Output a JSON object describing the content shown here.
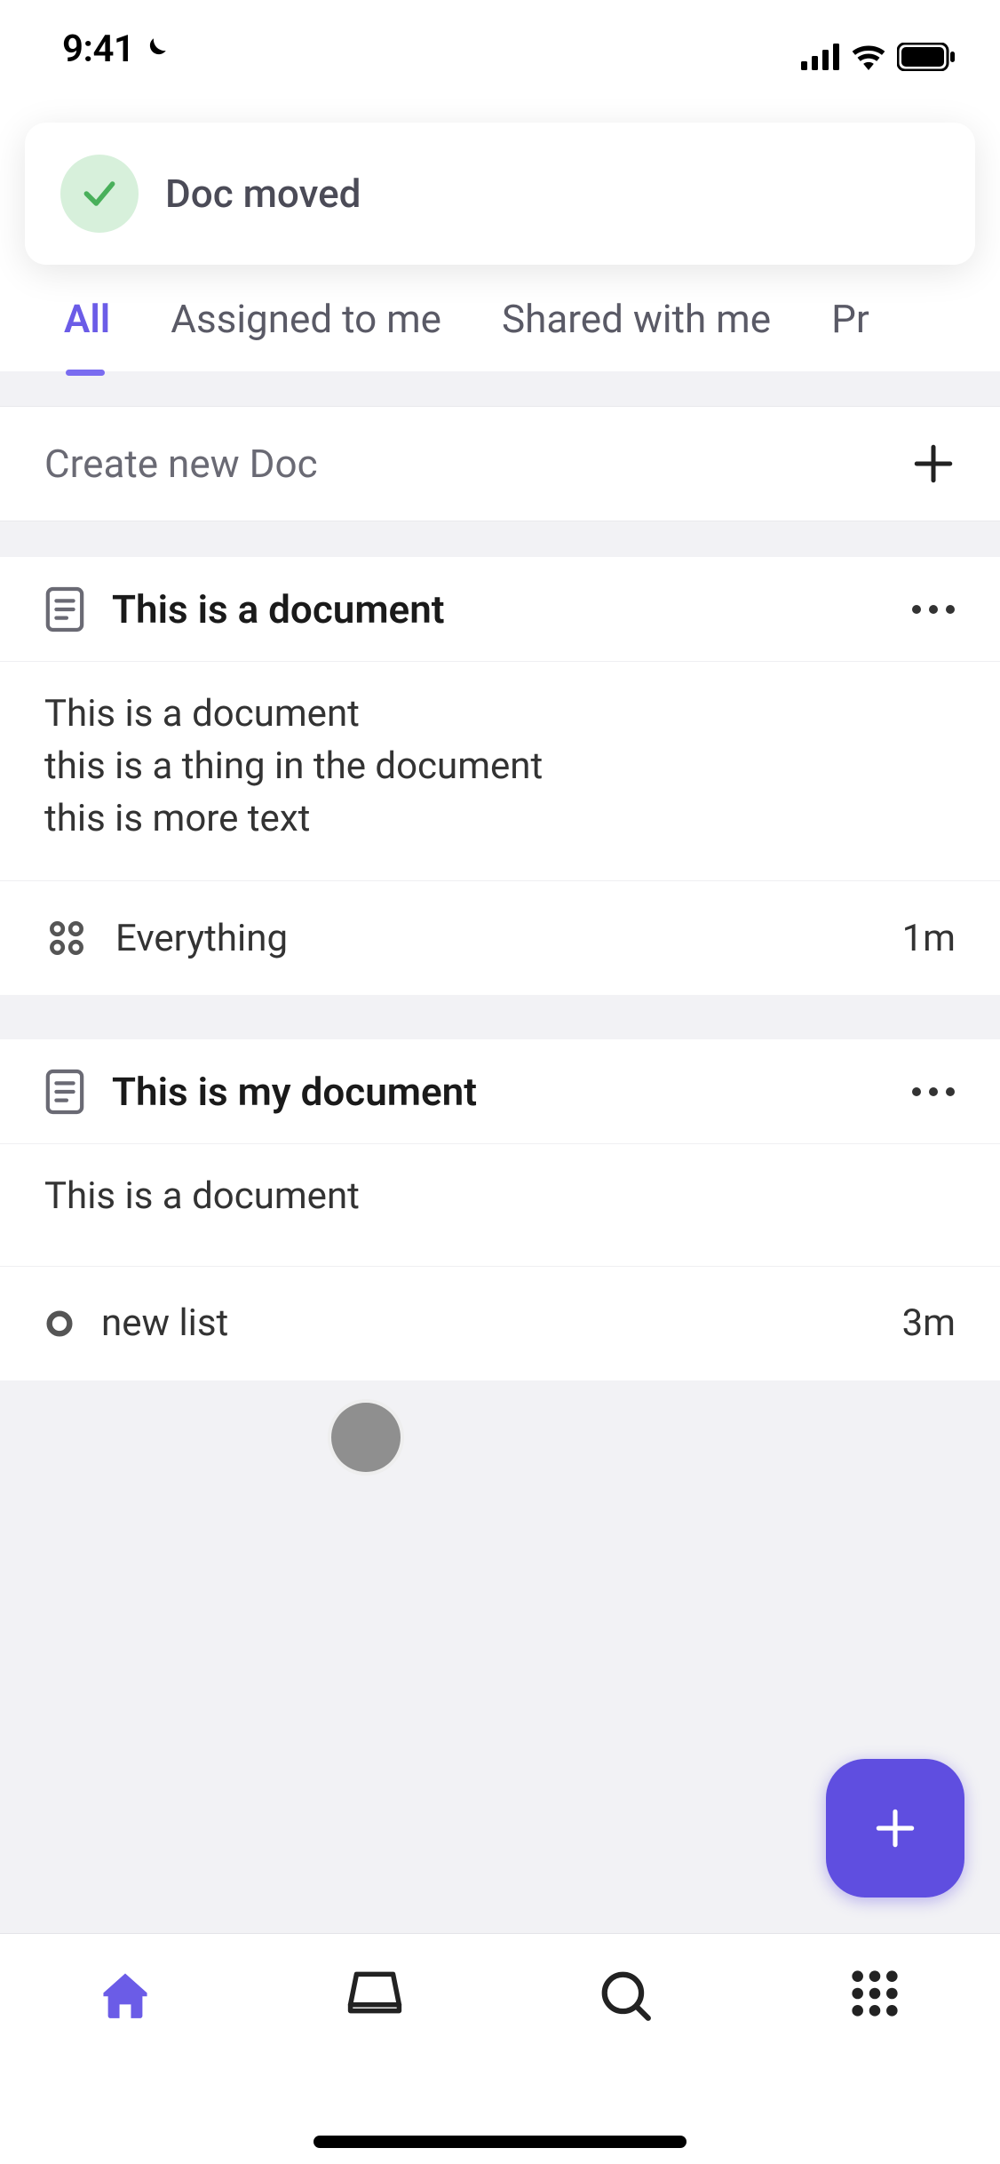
{
  "status": {
    "time": "9:41"
  },
  "toast": {
    "message": "Doc moved"
  },
  "tabs": [
    "All",
    "Assigned to me",
    "Shared with me",
    "Pr"
  ],
  "active_tab_index": 0,
  "create": {
    "label": "Create new Doc"
  },
  "docs": [
    {
      "title": "This is a document",
      "body_lines": [
        "This is a document",
        "this is a thing in the document",
        "this is more text"
      ],
      "location_icon": "grid-dots-icon",
      "location": "Everything",
      "time": "1m"
    },
    {
      "title": "This is my document",
      "body_lines": [
        "This is a document"
      ],
      "location_icon": "circle-outline-icon",
      "location": "new list",
      "time": "3m"
    }
  ],
  "colors": {
    "accent": "#6b5ce7",
    "fab": "#5f4ee0",
    "success_bg": "#d7f0db",
    "success_check": "#49b05b"
  }
}
